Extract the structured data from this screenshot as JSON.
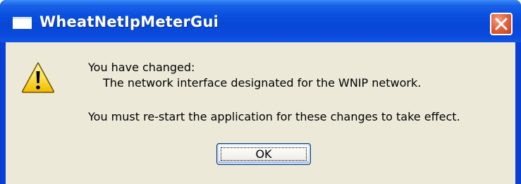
{
  "window": {
    "title": "WheatNetIpMeterGui",
    "title_icon": "window-app-icon",
    "close_icon": "close-x-icon",
    "titlebar_color": "#0a4bdc",
    "close_color": "#e2643f"
  },
  "dialog": {
    "icon": "warning-icon",
    "line1": "You have changed:",
    "line2": "The network interface designated for the WNIP network.",
    "line3": "You must re-start the application for these changes to take effect.",
    "ok_label": "OK"
  }
}
